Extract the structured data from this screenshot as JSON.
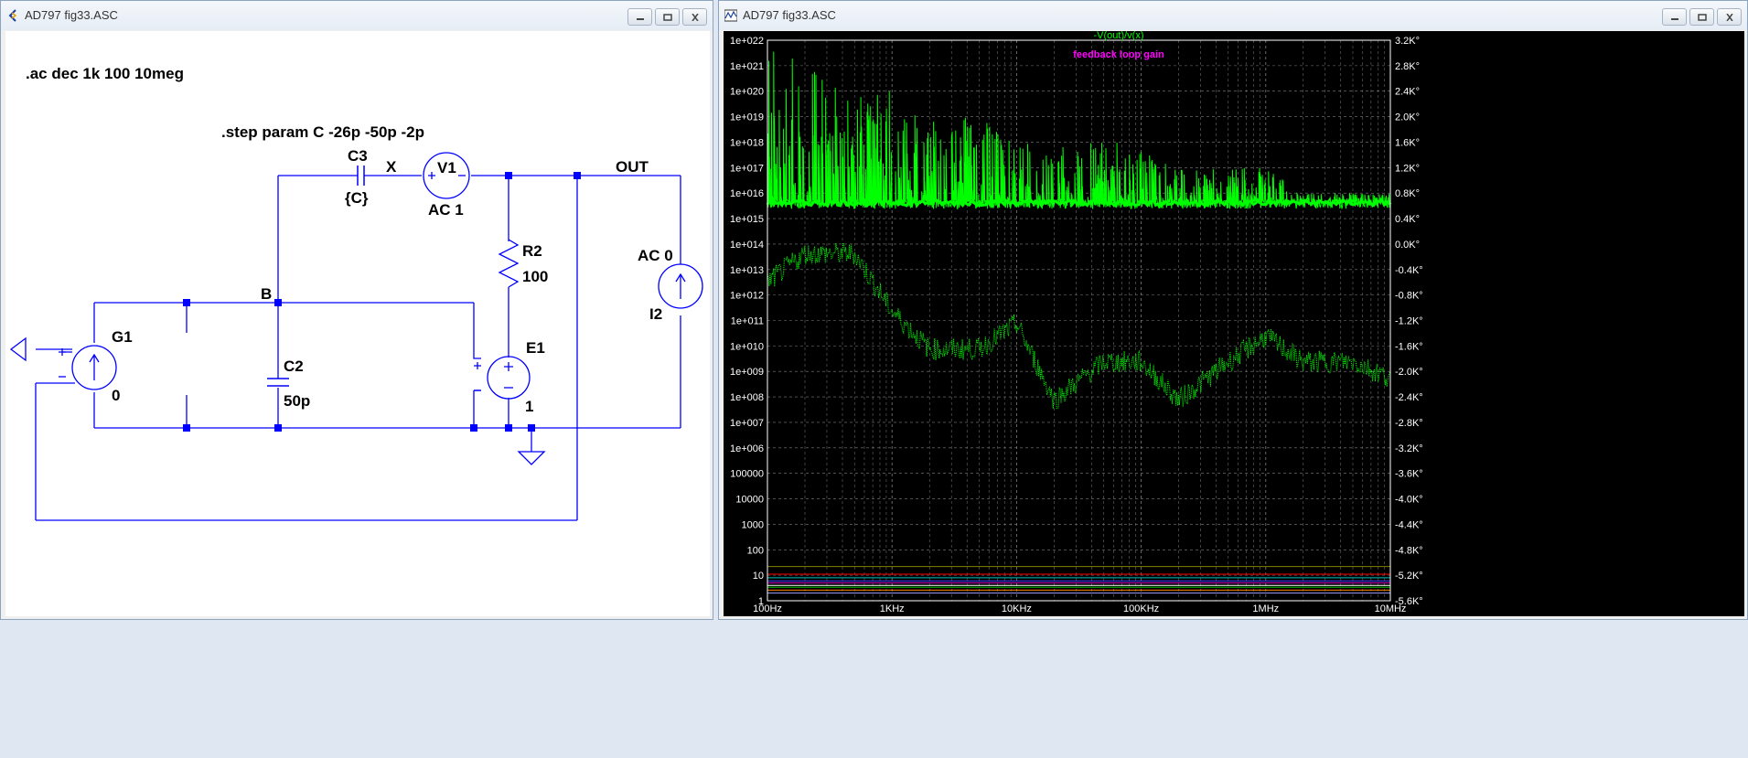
{
  "left_window": {
    "title": "AD797 fig33.ASC",
    "directive_ac": ".ac dec 1k 100 10meg",
    "directive_step": ".step param C -26p -50p -2p",
    "labels": {
      "c3": "C3",
      "c3_value": "{C}",
      "node_x": "X",
      "v1": "V1",
      "v1_value": "AC 1",
      "node_out": "OUT",
      "r2": "R2",
      "r2_value": "100",
      "i2_value": "AC 0",
      "i2": "I2",
      "node_b": "B",
      "g1": "G1",
      "g1_value": "0",
      "c2": "C2",
      "c2_value": "50p",
      "e1": "E1",
      "e1_value": "1"
    }
  },
  "right_window": {
    "title": "AD797 fig33.ASC",
    "trace_title": "-V(out)/v(x)",
    "annotation": "feedback loop gain",
    "colors": {
      "trace": "#00ff00",
      "annotation": "#ff00ff",
      "axis_text": "#ffffff",
      "schematic_wire": "#0000ff"
    },
    "x_ticks": [
      "100Hz",
      "1KHz",
      "10KHz",
      "100KHz",
      "1MHz",
      "10MHz"
    ],
    "y_left_ticks": [
      "1e+022",
      "1e+021",
      "1e+020",
      "1e+019",
      "1e+018",
      "1e+017",
      "1e+016",
      "1e+015",
      "1e+014",
      "1e+013",
      "1e+012",
      "1e+011",
      "1e+010",
      "1e+009",
      "1e+008",
      "1e+007",
      "1e+006",
      "100000",
      "10000",
      "1000",
      "100",
      "10",
      "1"
    ],
    "y_right_ticks": [
      "3.2K°",
      "2.8K°",
      "2.4K°",
      "2.0K°",
      "1.6K°",
      "1.2K°",
      "0.8K°",
      "0.4K°",
      "0.0K°",
      "-0.4K°",
      "-0.8K°",
      "-1.2K°",
      "-1.6K°",
      "-2.0K°",
      "-2.4K°",
      "-2.8K°",
      "-3.2K°",
      "-3.6K°",
      "-4.0K°",
      "-4.4K°",
      "-4.8K°",
      "-5.2K°",
      "-5.6K°"
    ]
  },
  "chart_data": {
    "type": "line",
    "title": "-V(out)/v(x)",
    "x_scale": "log",
    "xlim": [
      100,
      10000000
    ],
    "y_left_scale": "log",
    "ylim_left": [
      1,
      1e+22
    ],
    "ylim_right_deg": [
      -5600,
      3200
    ],
    "grid": true,
    "series": [
      {
        "name": "-V(out)/v(x)",
        "x": [
          100,
          200,
          500,
          1000,
          2000,
          5000,
          10000,
          20000,
          50000,
          100000,
          200000,
          500000,
          1000000,
          2000000,
          5000000,
          10000000
        ],
        "magnitude_envelope_max": [
          1e+22,
          1e+21,
          1e+20,
          1e+20,
          1e+19,
          1e+19,
          1e+18,
          1e+18,
          1e+18,
          1e+18,
          1e+17,
          1e+17,
          1e+17,
          1e+16,
          1e+16,
          1e+16
        ],
        "magnitude_baseline": [
          4000000000000000.0,
          4000000000000000.0,
          4000000000000000.0,
          4000000000000000.0,
          4000000000000000.0,
          4000000000000000.0,
          4000000000000000.0,
          4000000000000000.0,
          4000000000000000.0,
          4000000000000000.0,
          4000000000000000.0,
          4000000000000000.0,
          4000000000000000.0,
          4000000000000000.0,
          4000000000000000.0,
          4000000000000000.0
        ],
        "phase_deg": [
          -600,
          -150,
          -150,
          -1050,
          -1650,
          -1650,
          -1250,
          -2450,
          -1850,
          -1850,
          -2450,
          -1850,
          -1450,
          -1850,
          -1850,
          -2100
        ]
      }
    ]
  }
}
